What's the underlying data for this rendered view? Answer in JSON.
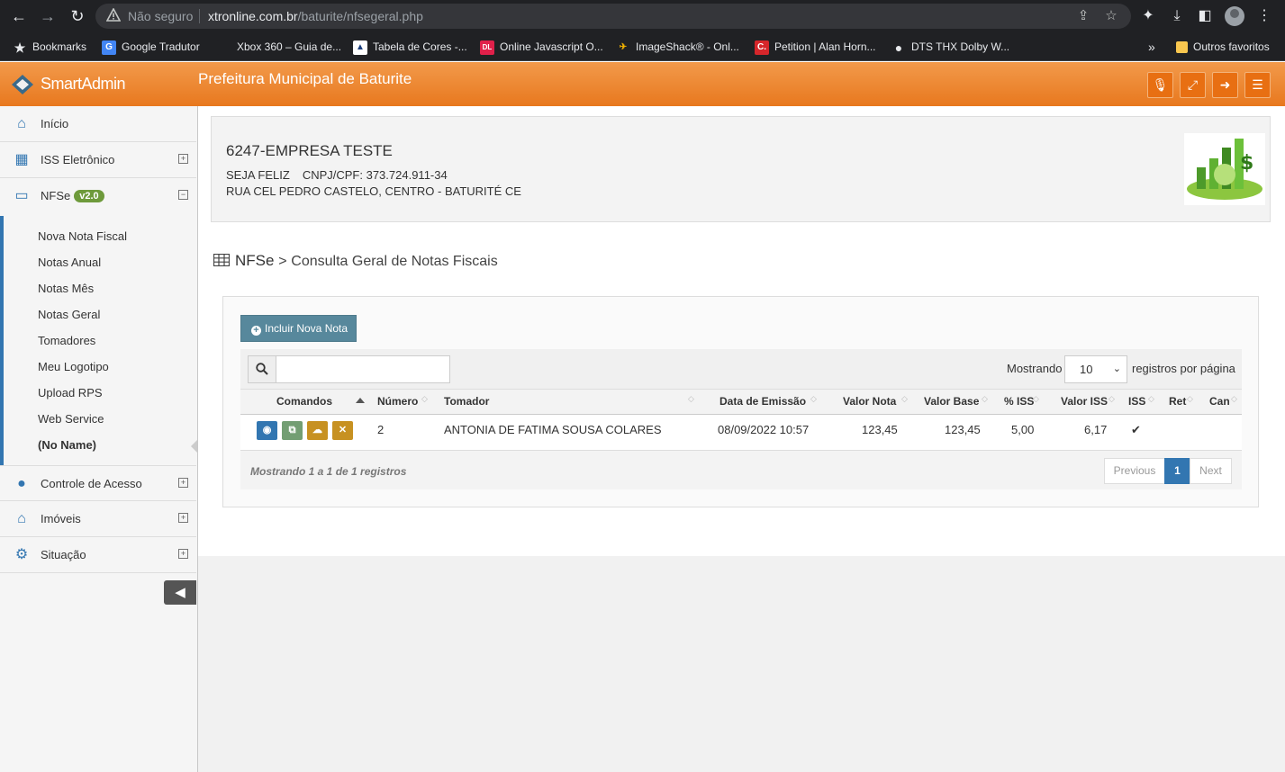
{
  "browser": {
    "security_label": "Não seguro",
    "url_host": "xtronline.com.br",
    "url_path": "/baturite/nfsegeral.php",
    "bookmarks": [
      {
        "label": "Bookmarks",
        "icon": "star-icon"
      },
      {
        "label": "Google Tradutor",
        "icon": "google-translate-icon"
      },
      {
        "label": "Xbox 360 – Guia de...",
        "icon": "xbox-icon"
      },
      {
        "label": "Tabela de Cores -...",
        "icon": "color-table-icon"
      },
      {
        "label": "Online Javascript O...",
        "icon": "dl-icon"
      },
      {
        "label": "ImageShack® - Onl...",
        "icon": "imageshack-icon"
      },
      {
        "label": "Petition | Alan Horn...",
        "icon": "petition-icon"
      },
      {
        "label": "DTS THX Dolby W...",
        "icon": "globe-icon"
      }
    ],
    "overflow_label": "»",
    "other_bookmarks": "Outros favoritos"
  },
  "header": {
    "logo_text": "SmartAdmin",
    "title": "Prefeitura Municipal de Baturite",
    "brand_color": "#ec8a34"
  },
  "sidebar": {
    "items": [
      {
        "label": "Início",
        "icon": "home-icon"
      },
      {
        "label": "ISS Eletrônico",
        "icon": "table-icon",
        "toggle": "⊞"
      },
      {
        "label": "NFSe",
        "icon": "inbox-icon",
        "badge": "v2.0",
        "toggle": "⊟"
      },
      {
        "label": "Controle de Acesso",
        "icon": "user-icon",
        "toggle": "⊞"
      },
      {
        "label": "Imóveis",
        "icon": "home-icon",
        "toggle": "⊞"
      },
      {
        "label": "Situação",
        "icon": "gear-icon",
        "toggle": "⊞"
      }
    ],
    "nfse_sub": [
      "Nova Nota Fiscal",
      "Notas Anual",
      "Notas Mês",
      "Notas Geral",
      "Tomadores",
      "Meu Logotipo",
      "Upload RPS",
      "Web Service",
      "(No Name)"
    ]
  },
  "company": {
    "name": "6247-EMPRESA TESTE",
    "fantasy": "SEJA FELIZ",
    "cnpj": "CNPJ/CPF: 373.724.911-34",
    "address": "RUA CEL PEDRO CASTELO, CENTRO - BATURITÉ CE"
  },
  "page": {
    "heading_main": "NFSe",
    "heading_sep": ">",
    "heading_sub": "Consulta Geral de Notas Fiscais"
  },
  "table": {
    "add_button": "Incluir Nova Nota",
    "search_value": "",
    "show_label": "Mostrando",
    "page_size": "10",
    "per_page_label": "registros por página",
    "columns": [
      "Comandos",
      "Número",
      "Tomador",
      "Data de Emissão",
      "Valor Nota",
      "Valor Base",
      "% ISS",
      "Valor ISS",
      "ISS",
      "Ret",
      "Can"
    ],
    "rows": [
      {
        "numero": "2",
        "tomador": "ANTONIA DE FATIMA SOUSA COLARES",
        "data_emissao": "08/09/2022 10:57",
        "valor_nota": "123,45",
        "valor_base": "123,45",
        "pct_iss": "5,00",
        "valor_iss": "6,17",
        "iss": "✔",
        "ret": "",
        "can": ""
      }
    ],
    "footer_info": "Mostrando 1 a 1 de 1 registros",
    "pager": {
      "previous": "Previous",
      "current": "1",
      "next": "Next"
    }
  }
}
